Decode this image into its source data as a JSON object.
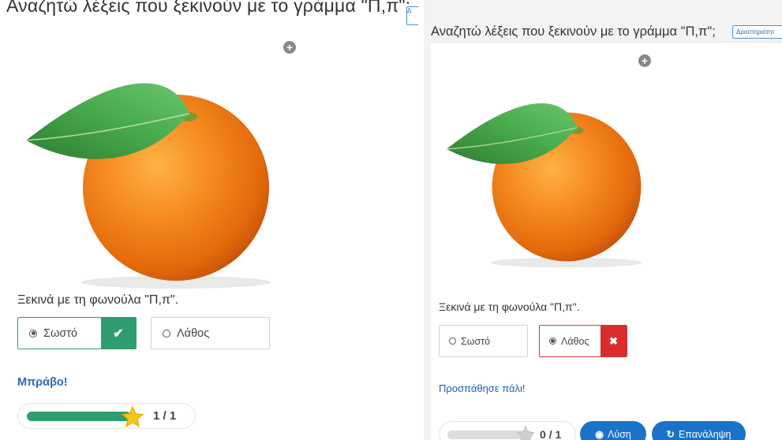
{
  "left": {
    "title": "Αναζητώ λέξεις που ξεκινούν με το γράμμα \"Π,π\";",
    "activity_tag": "Δ",
    "prompt": "Ξεκινά με τη φωνούλα \"Π,π\".",
    "options": {
      "correct": "Σωστό",
      "wrong": "Λάθος"
    },
    "feedback": "Μπράβο!",
    "score": {
      "text": "1 / 1",
      "progress": 1.0
    }
  },
  "right": {
    "title": "Αναζητώ λέξεις που ξεκινούν με το γράμμα \"Π,π\";",
    "activity_tag": "Δραστηριότητ",
    "prompt": "Ξεκινά με τη φωνούλα \"Π,π\".",
    "options": {
      "correct": "Σωστό",
      "wrong": "Λάθος"
    },
    "feedback": "Προσπάθησε πάλι!",
    "score": {
      "text": "0 / 1",
      "progress": 0.0
    },
    "buttons": {
      "solution": "Λύση",
      "retry": "Επανάληψη"
    }
  },
  "colors": {
    "correct": "#2e9e6e",
    "wrong": "#d92d2d",
    "accent": "#1a73c8",
    "star_active": "#f5c518",
    "star_inactive": "#d0d0d0"
  },
  "icons": {
    "zoom": "plus-circle-icon",
    "check": "check-icon",
    "cross": "x-icon",
    "eye": "eye-icon",
    "retry": "redo-icon",
    "star": "star-icon"
  }
}
